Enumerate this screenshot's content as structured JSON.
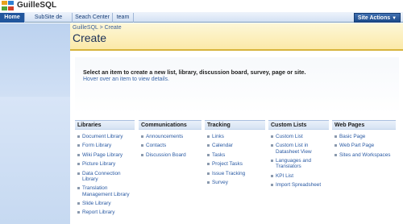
{
  "site": {
    "title": "GuilleSQL"
  },
  "tabs": [
    {
      "label": "Home",
      "active": true
    },
    {
      "label": "SubSite de Prueba",
      "active": false
    },
    {
      "label": "Seach Center",
      "active": false
    },
    {
      "label": "team",
      "active": false
    }
  ],
  "site_actions": {
    "label": "Site Actions"
  },
  "breadcrumb": "GuilleSQL > Create",
  "page_title": "Create",
  "instructions": {
    "line1": "Select an item to create a new list, library, discussion board, survey, page or site.",
    "line2": "Hover over an item to view details."
  },
  "categories": [
    {
      "header": "Libraries",
      "items": [
        "Document Library",
        "Form Library",
        "Wiki Page Library",
        "Picture Library",
        "Data Connection Library",
        "Translation Management Library",
        "Slide Library",
        "Report Library"
      ]
    },
    {
      "header": "Communications",
      "items": [
        "Announcements",
        "Contacts",
        "Discussion Board"
      ]
    },
    {
      "header": "Tracking",
      "items": [
        "Links",
        "Calendar",
        "Tasks",
        "Project Tasks",
        "Issue Tracking",
        "Survey"
      ]
    },
    {
      "header": "Custom Lists",
      "items": [
        "Custom List",
        "Custom List in Datasheet View",
        "Languages and Translators",
        "KPI List",
        "Import Spreadsheet"
      ]
    },
    {
      "header": "Web Pages",
      "items": [
        "Basic Page",
        "Web Part Page",
        "Sites and Workspaces"
      ]
    }
  ],
  "colors": {
    "accent": "#21569d",
    "title_band": "#fbe9a8",
    "link": "#2a5aa3"
  }
}
